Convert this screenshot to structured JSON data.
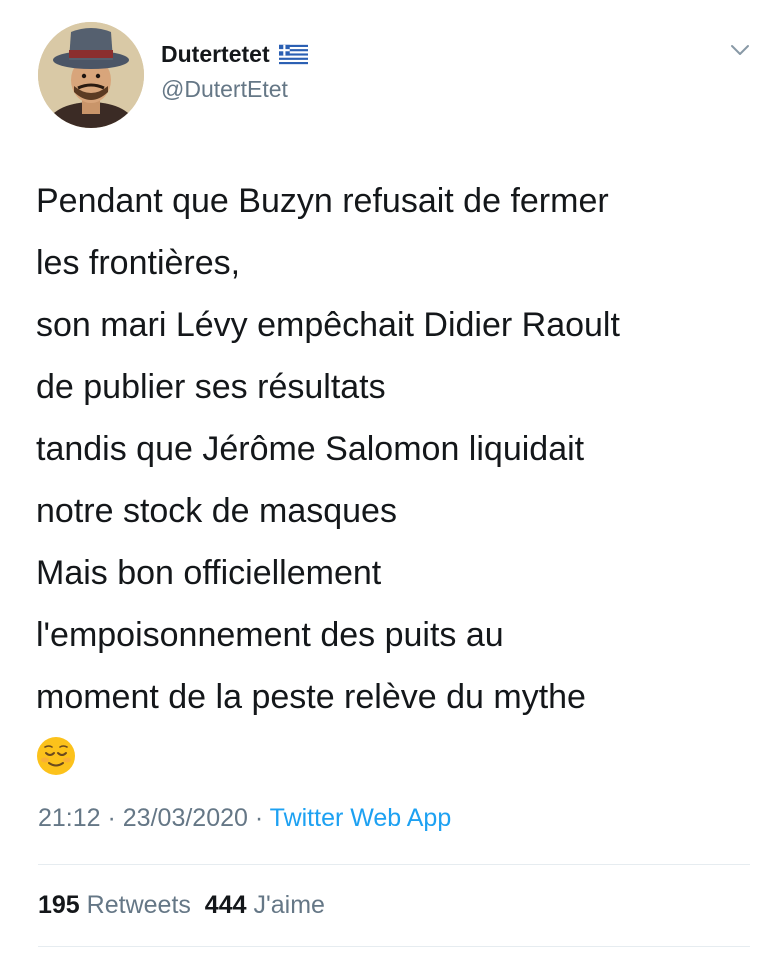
{
  "user": {
    "display_name": "Dutertetet",
    "handle": "@DutertEtet",
    "flag_icon": "greek-flag-icon"
  },
  "tweet": {
    "lines": [
      "Pendant que Buzyn refusait de fermer",
      "les frontières,",
      "son mari Lévy empêchait Didier Raoult",
      "de publier ses résultats",
      "tandis que Jérôme Salomon liquidait",
      "notre stock de masques",
      "Mais bon officiellement",
      "l'empoisonnement des puits au",
      "moment de la peste relève du mythe"
    ],
    "emoji": "relieved-face-emoji"
  },
  "meta": {
    "time": "21:12",
    "sep1": " · ",
    "date": "23/03/2020",
    "sep2": " · ",
    "source": "Twitter Web App"
  },
  "stats": {
    "retweets_count": "195",
    "retweets_label": "Retweets",
    "likes_count": "444",
    "likes_label": "J'aime"
  },
  "colors": {
    "text": "#14171a",
    "secondary": "#657786",
    "link": "#1da1f2",
    "divider": "#e6ecf0"
  }
}
